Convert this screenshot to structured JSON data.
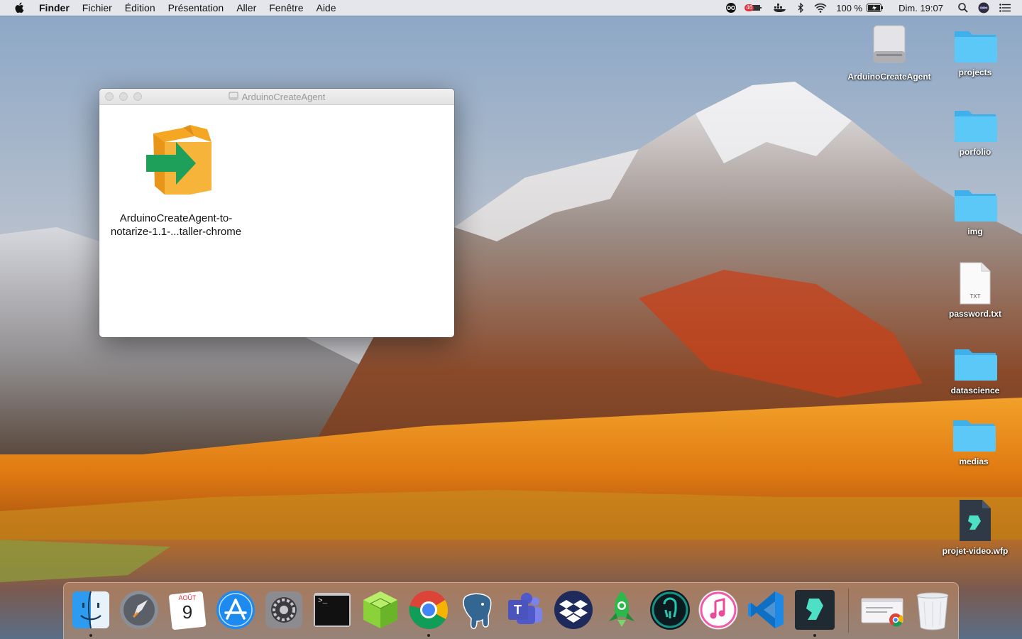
{
  "menubar": {
    "app_name": "Finder",
    "menus": [
      "Fichier",
      "Édition",
      "Présentation",
      "Aller",
      "Fenêtre",
      "Aide"
    ],
    "status": {
      "battery_badge": "46",
      "battery_text": "100 %",
      "clock": "Dim. 19:07"
    }
  },
  "window": {
    "title": "ArduinoCreateAgent",
    "file": {
      "label_line1": "ArduinoCreateAgent-to-",
      "label_line2": "notarize-1.1-...taller-chrome"
    }
  },
  "desktop": {
    "icons": [
      {
        "label": "ArduinoCreateAgent",
        "icon": "disk-image-icon"
      },
      {
        "label": "projects",
        "icon": "folder-icon"
      },
      {
        "label": "porfolio",
        "icon": "folder-icon"
      },
      {
        "label": "img",
        "icon": "folder-icon"
      },
      {
        "label": "password.txt",
        "icon": "text-file-icon",
        "badge": "TXT"
      },
      {
        "label": "datascience",
        "icon": "folder-icon"
      },
      {
        "label": "medias",
        "icon": "folder-icon"
      },
      {
        "label": "projet-video.wfp",
        "icon": "filmora-file-icon"
      }
    ]
  },
  "dock": {
    "calendar_month": "AOÛT",
    "calendar_day": "9",
    "terminal_prompt": ">_",
    "teams_letter": "T",
    "apps": [
      "finder-icon",
      "launchpad-icon",
      "calendar-icon",
      "app-store-icon",
      "system-preferences-icon",
      "terminal-icon",
      "sketchup-cube-icon",
      "chrome-icon",
      "postgresql-icon",
      "teams-icon",
      "dropbox-icon",
      "rocket-app-icon",
      "gitkraken-icon",
      "itunes-icon",
      "vscode-icon",
      "filmora-icon",
      "chrome-download-icon",
      "trash-icon"
    ]
  },
  "colors": {
    "folder": "#4fc3f7",
    "accent_orange": "#f5a623",
    "arrow_green": "#1ea05a"
  }
}
